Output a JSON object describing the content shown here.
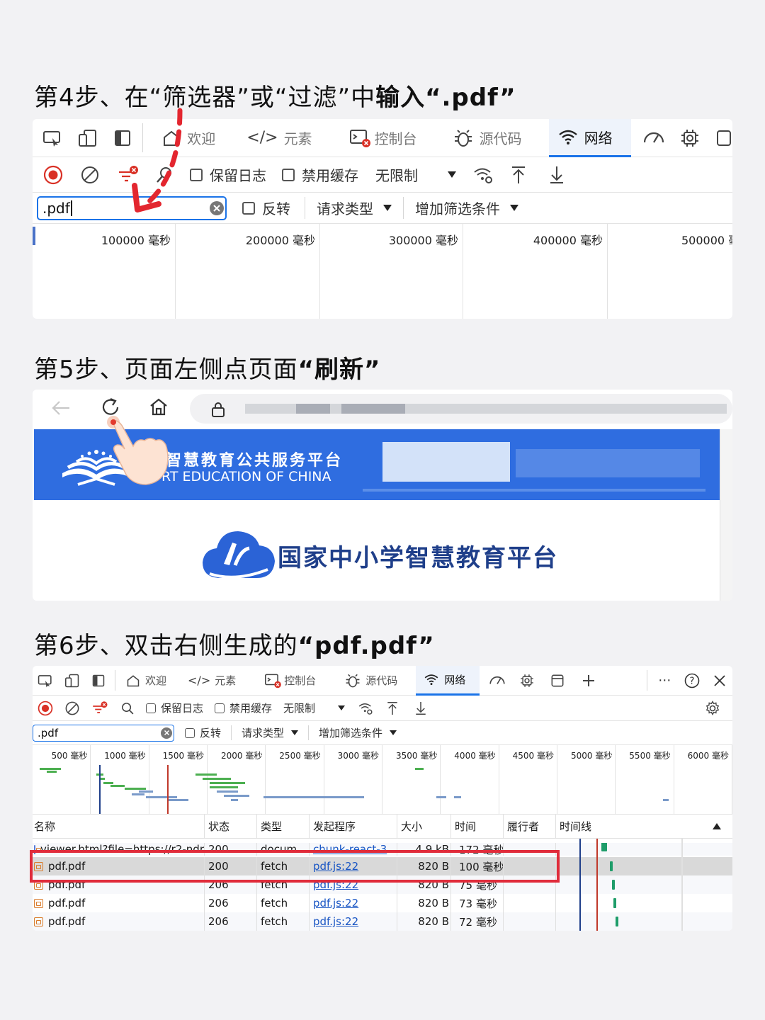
{
  "steps": {
    "step4": {
      "prefix": "第4步、在“筛选器”或“过滤”中",
      "bold": "输入“.pdf”"
    },
    "step5": {
      "prefix": "第5步、页面左侧点页面",
      "bold": "“刷新”"
    },
    "step6": {
      "prefix": "第6步、双击右侧生成的",
      "bold": "“pdf.pdf”"
    }
  },
  "colors": {
    "accent": "#1a73e8",
    "record_red": "#d93025",
    "highlight": "#e02c3b",
    "banner_blue": "#2f6de0",
    "waterfall_green": "#1f9d6a"
  },
  "devtools_tabs": {
    "welcome": "欢迎",
    "elements": "元素",
    "console": "控制台",
    "sources": "源代码",
    "network": "网络"
  },
  "controls": {
    "preserve_log": "保留日志",
    "disable_cache": "禁用缓存",
    "throttle": "无限制"
  },
  "filter": {
    "value1": ".pdf",
    "value3": ".pdf",
    "invert": "反转",
    "request_type": "请求类型",
    "more_filters": "增加筛选条件"
  },
  "timeline1": [
    "100000 毫秒",
    "200000 毫秒",
    "300000 毫秒",
    "400000 毫秒",
    "500000 毫"
  ],
  "timeline3": [
    "500 毫秒",
    "1000 毫秒",
    "1500 毫秒",
    "2000 毫秒",
    "2500 毫秒",
    "3000 毫秒",
    "3500 毫秒",
    "4000 毫秒",
    "4500 毫秒",
    "5000 毫秒",
    "5500 毫秒",
    "6000 毫秒"
  ],
  "browser": {
    "banner_cn": "智慧教育公共服务平台",
    "banner_en": "RT EDUCATION OF CHINA",
    "platform_title": "国家中小学智慧教育平台"
  },
  "table": {
    "headers": [
      "名称",
      "状态",
      "类型",
      "发起程序",
      "大小",
      "时间",
      "履行者",
      "时间线"
    ],
    "rows": [
      {
        "name": "viewer.html?file=https://r2-ndr",
        "status": "200",
        "type": "docum",
        "initiator": "chunk-react-3",
        "size": "4.9 kB",
        "time": "172 毫秒",
        "bar": 0.24
      },
      {
        "name": "pdf.pdf",
        "status": "200",
        "type": "fetch",
        "initiator": "pdf.js:22",
        "size": "820 B",
        "time": "100 毫秒",
        "bar": 0.29
      },
      {
        "name": "pdf.pdf",
        "status": "206",
        "type": "fetch",
        "initiator": "pdf.js:22",
        "size": "820 B",
        "time": "75 毫秒",
        "bar": 0.3
      },
      {
        "name": "pdf.pdf",
        "status": "206",
        "type": "fetch",
        "initiator": "pdf.js:22",
        "size": "820 B",
        "time": "73 毫秒",
        "bar": 0.31
      },
      {
        "name": "pdf.pdf",
        "status": "206",
        "type": "fetch",
        "initiator": "pdf.js:22",
        "size": "820 B",
        "time": "72 毫秒",
        "bar": 0.32
      }
    ]
  }
}
